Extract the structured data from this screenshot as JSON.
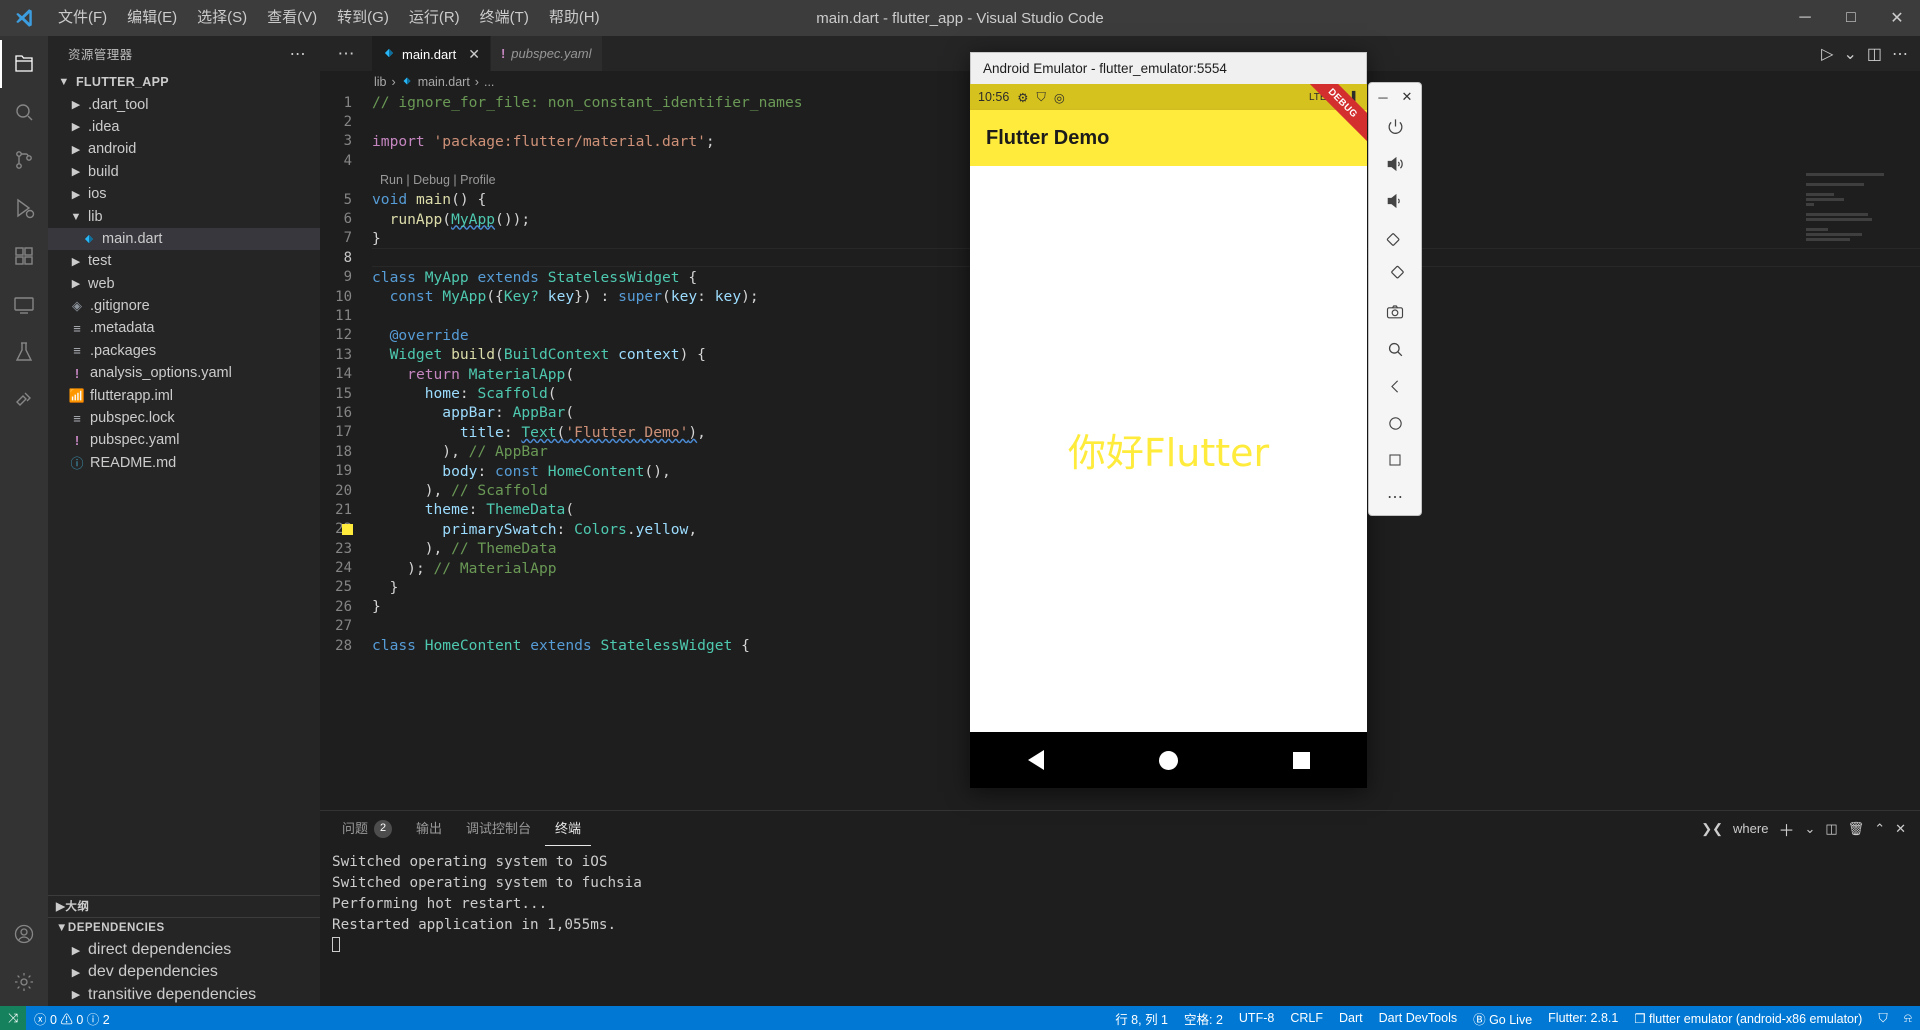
{
  "window": {
    "title": "main.dart - flutter_app - Visual Studio Code",
    "menu": [
      "文件(F)",
      "编辑(E)",
      "选择(S)",
      "查看(V)",
      "转到(G)",
      "运行(R)",
      "终端(T)",
      "帮助(H)"
    ],
    "controls": {
      "minimize": "─",
      "maximize": "□",
      "close": "✕"
    }
  },
  "activitybar": {
    "items": [
      {
        "name": "explorer-icon",
        "glyph": "❐",
        "active": true
      },
      {
        "name": "search-icon",
        "glyph": "⌕",
        "active": false
      },
      {
        "name": "source-control-icon",
        "glyph": "⎇",
        "active": false
      },
      {
        "name": "run-debug-icon",
        "glyph": "▷",
        "active": false
      },
      {
        "name": "extensions-icon",
        "glyph": "⊞",
        "active": false
      },
      {
        "name": "remote-explorer-icon",
        "glyph": "▣",
        "active": false
      },
      {
        "name": "testing-icon",
        "glyph": "⚗",
        "active": false
      },
      {
        "name": "flutter-icon",
        "glyph": "⚒",
        "active": false
      }
    ],
    "bottom": [
      {
        "name": "accounts-icon",
        "glyph": "○"
      },
      {
        "name": "settings-gear-icon",
        "glyph": "⚙"
      }
    ]
  },
  "sidebar": {
    "header": "资源管理器",
    "more_actions": "⋯",
    "root": "FLUTTER_APP",
    "items": [
      {
        "label": ".dart_tool",
        "type": "folder",
        "expanded": false,
        "indent": 1
      },
      {
        "label": ".idea",
        "type": "folder",
        "expanded": false,
        "indent": 1
      },
      {
        "label": "android",
        "type": "folder",
        "expanded": false,
        "indent": 1
      },
      {
        "label": "build",
        "type": "folder",
        "expanded": false,
        "indent": 1
      },
      {
        "label": "ios",
        "type": "folder",
        "expanded": false,
        "indent": 1
      },
      {
        "label": "lib",
        "type": "folder",
        "expanded": true,
        "indent": 1
      },
      {
        "label": "main.dart",
        "type": "dart",
        "selected": true,
        "indent": 2
      },
      {
        "label": "test",
        "type": "folder",
        "expanded": false,
        "indent": 1
      },
      {
        "label": "web",
        "type": "folder",
        "expanded": false,
        "indent": 1
      },
      {
        "label": ".gitignore",
        "type": "git",
        "indent": 1
      },
      {
        "label": ".metadata",
        "type": "text",
        "indent": 1
      },
      {
        "label": ".packages",
        "type": "text",
        "indent": 1
      },
      {
        "label": "analysis_options.yaml",
        "type": "yaml",
        "indent": 1
      },
      {
        "label": "flutterapp.iml",
        "type": "iml",
        "indent": 1
      },
      {
        "label": "pubspec.lock",
        "type": "text",
        "indent": 1
      },
      {
        "label": "pubspec.yaml",
        "type": "yaml",
        "indent": 1
      },
      {
        "label": "README.md",
        "type": "info",
        "indent": 1
      }
    ],
    "outline_section": "大纲",
    "dependencies_section": "DEPENDENCIES",
    "dependencies": [
      "direct dependencies",
      "dev dependencies",
      "transitive dependencies"
    ]
  },
  "editor": {
    "tabs": [
      {
        "label": "main.dart",
        "icon": "dart-icon",
        "active": true,
        "dirty": false,
        "close": "✕"
      },
      {
        "label": "pubspec.yaml",
        "icon": "yaml-icon",
        "active": false,
        "preview": true
      }
    ],
    "actions": [
      {
        "name": "run-play-icon",
        "glyph": "▷"
      },
      {
        "name": "chevron-down-icon",
        "glyph": "⌄"
      },
      {
        "name": "split-editor-icon",
        "glyph": "◫"
      },
      {
        "name": "more-actions-icon",
        "glyph": "⋯"
      }
    ],
    "breadcrumb": [
      "lib",
      "main.dart",
      "..."
    ],
    "codelens": "Run | Debug | Profile",
    "codelens_line": 5,
    "current_line": 8,
    "swatch_line": 22,
    "swatch_color": "#ffeb3b",
    "lines": [
      {
        "n": 1,
        "html": "<span class='c'>// ignore_for_file: non_constant_identifier_names</span>"
      },
      {
        "n": 2,
        "html": ""
      },
      {
        "n": 3,
        "html": "<span class='kw2'>import</span> <span class='str'>'package:flutter/material.dart'</span><span class='pl'>;</span>"
      },
      {
        "n": 4,
        "html": ""
      },
      {
        "n": 5,
        "html": "<span class='kw'>void</span> <span class='fn'>main</span><span class='pl'>() {</span>"
      },
      {
        "n": 6,
        "html": "  <span class='fn'>runApp</span><span class='pl'>(</span><span class='typ squiggle'>MyApp</span><span class='pl'>());</span>"
      },
      {
        "n": 7,
        "html": "<span class='pl'>}</span>"
      },
      {
        "n": 8,
        "html": ""
      },
      {
        "n": 9,
        "html": "<span class='kw'>class</span> <span class='typ'>MyApp</span> <span class='kw'>extends</span> <span class='typ'>StatelessWidget</span> <span class='pl'>{</span>"
      },
      {
        "n": 10,
        "html": "  <span class='kw'>const</span> <span class='typ'>MyApp</span><span class='pl'>({</span><span class='typ'>Key?</span> <span class='id'>key</span><span class='pl'>}) : </span><span class='kw'>super</span><span class='pl'>(</span><span class='id'>key</span><span class='pl'>: </span><span class='id'>key</span><span class='pl'>);</span>"
      },
      {
        "n": 11,
        "html": ""
      },
      {
        "n": 12,
        "html": "  <span class='kw'>@override</span>"
      },
      {
        "n": 13,
        "html": "  <span class='typ'>Widget</span> <span class='fn'>build</span><span class='pl'>(</span><span class='typ'>BuildContext</span> <span class='id'>context</span><span class='pl'>) {</span>"
      },
      {
        "n": 14,
        "html": "    <span class='kw2'>return</span> <span class='typ'>MaterialApp</span><span class='pl'>(</span>"
      },
      {
        "n": 15,
        "html": "      <span class='id'>home</span><span class='pl'>: </span><span class='typ'>Scaffold</span><span class='pl'>(</span>"
      },
      {
        "n": 16,
        "html": "        <span class='id'>appBar</span><span class='pl'>: </span><span class='typ'>AppBar</span><span class='pl'>(</span>"
      },
      {
        "n": 17,
        "html": "          <span class='id'>title</span><span class='pl'>: </span><span class='typ squiggle'>Text</span><span class='pl squiggle'>(</span><span class='str squiggle'>'Flutter Demo'</span><span class='pl squiggle'>)</span><span class='pl'>,</span>"
      },
      {
        "n": 18,
        "html": "        <span class='pl'>), </span><span class='c'>// AppBar</span>"
      },
      {
        "n": 19,
        "html": "        <span class='id'>body</span><span class='pl'>: </span><span class='kw'>const</span> <span class='typ'>HomeContent</span><span class='pl'>(),</span>"
      },
      {
        "n": 20,
        "html": "      <span class='pl'>), </span><span class='c'>// Scaffold</span>"
      },
      {
        "n": 21,
        "html": "      <span class='id'>theme</span><span class='pl'>: </span><span class='typ'>ThemeData</span><span class='pl'>(</span>"
      },
      {
        "n": 22,
        "html": "        <span class='id'>primarySwatch</span><span class='pl'>: </span><span class='typ'>Colors</span><span class='pl'>.</span><span class='id'>yellow</span><span class='pl'>,</span>"
      },
      {
        "n": 23,
        "html": "      <span class='pl'>), </span><span class='c'>// ThemeData</span>"
      },
      {
        "n": 24,
        "html": "    <span class='pl'>); </span><span class='c'>// MaterialApp</span>"
      },
      {
        "n": 25,
        "html": "  <span class='pl'>}</span>"
      },
      {
        "n": 26,
        "html": "<span class='pl'>}</span>"
      },
      {
        "n": 27,
        "html": ""
      },
      {
        "n": 28,
        "html": "<span class='kw'>class</span> <span class='typ'>HomeContent</span> <span class='kw'>extends</span> <span class='typ'>StatelessWidget</span> <span class='pl'>{</span>"
      }
    ]
  },
  "panel": {
    "tabs": [
      {
        "label": "问题",
        "badge": "2",
        "active": false
      },
      {
        "label": "输出",
        "active": false
      },
      {
        "label": "调试控制台",
        "active": false
      },
      {
        "label": "终端",
        "active": true
      }
    ],
    "actions": [
      {
        "name": "terminal-selector-icon",
        "glyph": "❯❮"
      },
      {
        "name": "terminal-name-label",
        "glyph": "where"
      },
      {
        "name": "new-terminal-icon",
        "glyph": "＋"
      },
      {
        "name": "chevron-down-icon",
        "glyph": "⌄"
      },
      {
        "name": "split-terminal-icon",
        "glyph": "◫"
      },
      {
        "name": "kill-terminal-icon",
        "glyph": "🗑"
      },
      {
        "name": "maximize-panel-icon",
        "glyph": "⌃"
      },
      {
        "name": "close-panel-icon",
        "glyph": "✕"
      }
    ],
    "terminal_lines": [
      "Switched operating system to iOS",
      "",
      "Switched operating system to fuchsia",
      "",
      "Performing hot restart...",
      "Restarted application in 1,055ms."
    ]
  },
  "statusbar": {
    "remote_icon": "⤨",
    "left": [
      {
        "name": "problems-status",
        "text": "ⓧ 0  ⚠ 0  ⓘ 2"
      }
    ],
    "right": [
      {
        "name": "cursor-position-status",
        "text": "行 8, 列 1"
      },
      {
        "name": "indentation-status",
        "text": "空格: 2"
      },
      {
        "name": "encoding-status",
        "text": "UTF-8"
      },
      {
        "name": "eol-status",
        "text": "CRLF"
      },
      {
        "name": "language-mode-status",
        "text": "Dart"
      },
      {
        "name": "dart-devtools-status",
        "text": "Dart DevTools"
      },
      {
        "name": "go-live-status",
        "text": "Ⓑ Go Live"
      },
      {
        "name": "flutter-version-status",
        "text": "Flutter: 2.8.1"
      },
      {
        "name": "device-selector-status",
        "text": "❐ flutter emulator (android-x86 emulator)"
      },
      {
        "name": "accounts-status",
        "text": "⛉"
      },
      {
        "name": "notifications-status",
        "text": "⍾"
      }
    ]
  },
  "emulator": {
    "title": "Android Emulator - flutter_emulator:5554",
    "status_time": "10:56",
    "status_icons": [
      "⚙",
      "⛉",
      "◎"
    ],
    "status_right": "LTE ▲▼ ▌",
    "appbar_title": "Flutter Demo",
    "debug_ribbon": "DEBUG",
    "content_text": "你好Flutter",
    "content_color": "#ffeb3b",
    "nav": [
      {
        "name": "nav-back-button",
        "shape": "triangle"
      },
      {
        "name": "nav-home-button",
        "shape": "circle"
      },
      {
        "name": "nav-recents-button",
        "shape": "square"
      }
    ],
    "toolbar": {
      "minimize": "─",
      "close": "✕",
      "buttons": [
        {
          "name": "power-icon",
          "glyph": "⏻"
        },
        {
          "name": "volume-up-icon",
          "glyph": "🔊"
        },
        {
          "name": "volume-down-icon",
          "glyph": "🔉"
        },
        {
          "name": "rotate-left-icon",
          "glyph": "◱"
        },
        {
          "name": "rotate-right-icon",
          "glyph": "◳"
        },
        {
          "name": "screenshot-camera-icon",
          "glyph": "📷"
        },
        {
          "name": "zoom-icon",
          "glyph": "⌕"
        },
        {
          "name": "back-icon",
          "glyph": "◁"
        },
        {
          "name": "home-icon",
          "glyph": "○"
        },
        {
          "name": "overview-icon",
          "glyph": "□"
        },
        {
          "name": "more-icon",
          "glyph": "⋯"
        }
      ]
    }
  }
}
